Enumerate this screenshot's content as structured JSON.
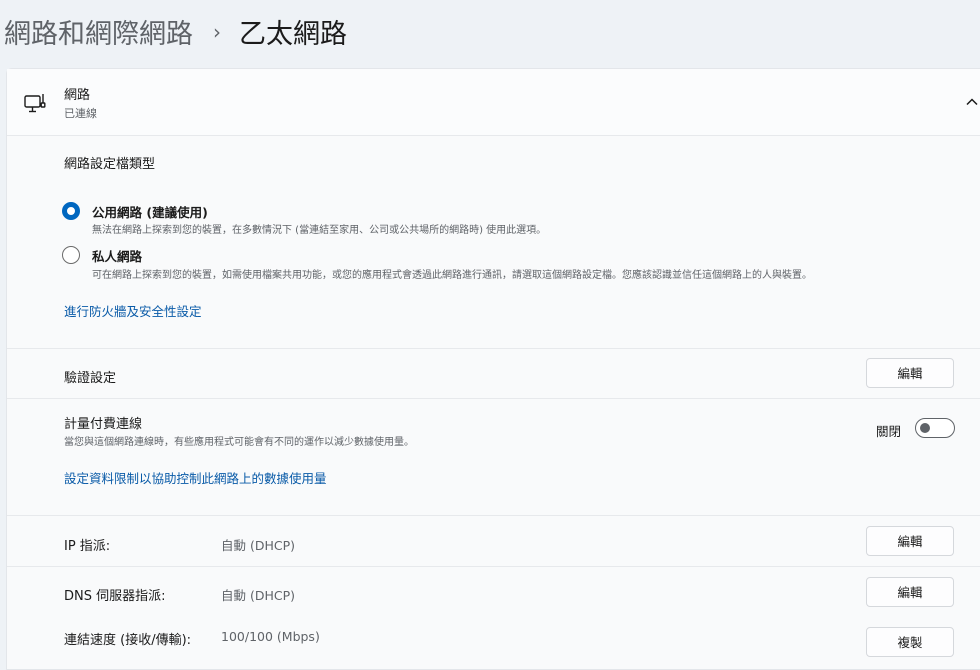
{
  "breadcrumb": {
    "parent": "網路和網際網路",
    "separator": "›",
    "current": "乙太網路"
  },
  "network": {
    "title": "網路",
    "status": "已連線",
    "icon": "ethernet-monitor-icon",
    "expand_icon": "chevron-up-icon"
  },
  "profile": {
    "section_label": "網路設定檔類型",
    "options": [
      {
        "title": "公用網路 (建議使用)",
        "description": "無法在網路上探索到您的裝置，在多數情況下 (當連結至家用、公司或公共場所的網路時) 使用此選項。",
        "checked": true
      },
      {
        "title": "私人網路",
        "description": "可在網路上探索到您的裝置，如需使用檔案共用功能，或您的應用程式會透過此網路進行通訊，請選取這個網路設定檔。您應該認識並信任這個網路上的人與裝置。",
        "checked": false
      }
    ],
    "firewall_link": "進行防火牆及安全性設定"
  },
  "auth": {
    "label": "驗證設定",
    "button": "編輯"
  },
  "metered": {
    "label": "計量付費連線",
    "description": "當您與這個網路連線時，有些應用程式可能會有不同的運作以減少數據使用量。",
    "toggle_label": "關閉",
    "toggle_on": false,
    "data_limit_link": "設定資料限制以協助控制此網路上的數據使用量"
  },
  "properties": {
    "ip": {
      "label": "IP 指派:",
      "value": "自動 (DHCP)",
      "button": "編輯"
    },
    "dns": {
      "label": "DNS 伺服器指派:",
      "value": "自動 (DHCP)",
      "button": "編輯"
    },
    "speed": {
      "label": "連結速度 (接收/傳輸):",
      "value": "100/100 (Mbps)",
      "button": "複製"
    }
  },
  "colors": {
    "accent": "#0067c0",
    "link": "#0a5ba8",
    "background": "#eef2f6",
    "panel": "#f9fafb"
  }
}
